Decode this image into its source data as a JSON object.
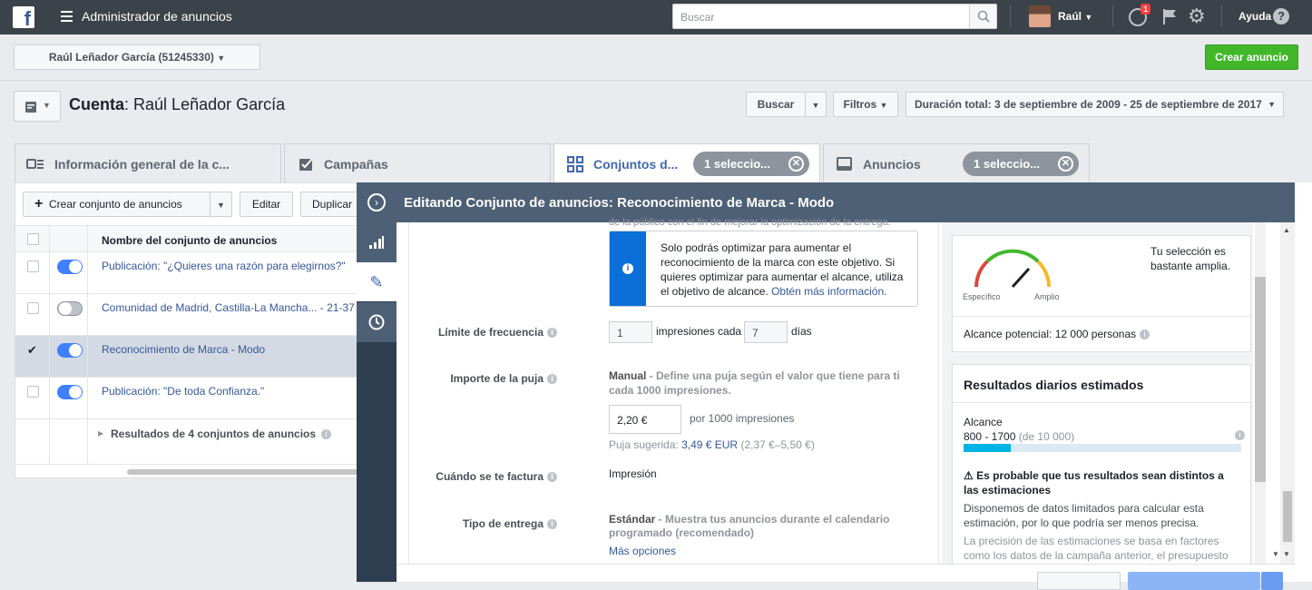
{
  "topbar": {
    "app_title": "Administrador de anuncios",
    "search_placeholder": "Buscar",
    "user_name": "Raúl",
    "notifications": "1",
    "help": "Ayuda"
  },
  "account_selector": "Raúl Leñador García (51245330)",
  "create_ad": "Crear anuncio",
  "account": {
    "label": "Cuenta",
    "name": "Raúl Leñador García"
  },
  "toolbar": {
    "search": "Buscar",
    "filters": "Filtros",
    "duration": "Duración total: 3 de septiembre de 2009 - 25 de septiembre de 2017"
  },
  "tabs": [
    {
      "label": "Información general de la c..."
    },
    {
      "label": "Campañas"
    },
    {
      "label": "Conjuntos d...",
      "pill": "1 seleccio..."
    },
    {
      "label": "Anuncios",
      "pill": "1 seleccio..."
    }
  ],
  "table": {
    "create_btn": "Crear conjunto de anuncios",
    "edit_btn": "Editar",
    "duplicate_btn": "Duplicar",
    "header": "Nombre del conjunto de anuncios",
    "rows": [
      {
        "name": "Publicación: \"¿Quieres una razón para elegirnos?\"",
        "on": true,
        "checked": false
      },
      {
        "name": "Comunidad de Madrid, Castilla-La Mancha... - 21-37",
        "on": false,
        "checked": false
      },
      {
        "name": "Reconocimiento de Marca - Modo",
        "on": true,
        "checked": true
      },
      {
        "name": "Publicación: \"De toda Confianza.\"",
        "on": true,
        "checked": false
      }
    ],
    "results": "Resultados de 4 conjuntos de anuncios"
  },
  "editor": {
    "title": "Editando Conjunto de anuncios: Reconocimiento de Marca - Modo",
    "cut_text": "de la público con el fin de mejorar la optimización de la entrega.",
    "notice": "Solo podrás optimizar para aumentar el reconocimiento de la marca con este objetivo. Si quieres optimizar para aumentar el alcance, utiliza el objetivo de alcance.",
    "notice_link": "Obtén más información.",
    "freq_label": "Límite de frecuencia",
    "freq_value": "1",
    "freq_mid": "impresiones cada",
    "freq_days": "7",
    "freq_unit": "días",
    "bid_label": "Importe de la puja",
    "bid_mode": "Manual",
    "bid_desc": " - Define una puja según el valor que tiene para ti cada 1000 impresiones.",
    "bid_value": "2,20 €",
    "bid_unit": "por 1000 impresiones",
    "suggested_label": "Puja sugerida:",
    "suggested_value": "3,49 € EUR",
    "suggested_range": "(2,37 €–5,50 €)",
    "billing_label": "Cuándo se te factura",
    "billing_value": "Impresión",
    "delivery_label": "Tipo de entrega",
    "delivery_mode": "Estándar",
    "delivery_desc": " - Muestra tus anuncios durante el calendario programado (recomendado)",
    "more_options": "Más opciones"
  },
  "audience": {
    "specific": "Específico",
    "broad": "Amplio",
    "selection": "Tu selección es bastante amplia.",
    "reach": "Alcance potencial: 12 000 personas"
  },
  "daily": {
    "title": "Resultados diarios estimados",
    "reach_label": "Alcance",
    "reach_range": "800 - 1700",
    "reach_of": "(de 10 000)",
    "reach_fraction": 0.17,
    "warning_title": "Es probable que tus resultados sean distintos a las estimaciones",
    "warning_1": "Disponemos de datos limitados para calcular esta estimación, por lo que podría ser menos precisa.",
    "warning_2": "La precisión de las estimaciones se basa en factores como los datos de la campaña anterior, el presupuesto"
  }
}
